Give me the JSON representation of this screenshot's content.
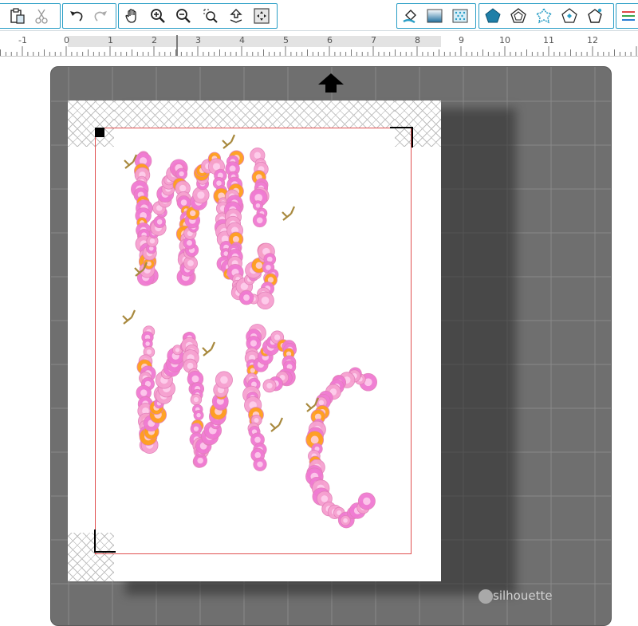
{
  "toolbar": {
    "groups": [
      {
        "name": "clipboard",
        "icons": [
          "paste-icon",
          "cut-icon"
        ]
      },
      {
        "name": "history",
        "icons": [
          "undo-icon",
          "redo-icon"
        ]
      },
      {
        "name": "view",
        "icons": [
          "pan-hand-icon",
          "zoom-in-icon",
          "zoom-out-icon",
          "zoom-select-icon",
          "zoom-fit-icon",
          "fit-to-page-icon"
        ]
      },
      {
        "name": "fill",
        "icons": [
          "fill-bucket-icon",
          "gradient-icon",
          "pattern-icon"
        ]
      },
      {
        "name": "panels",
        "icons": [
          "pentagon-filled-icon",
          "offset-icon",
          "trace-icon",
          "replicate-icon",
          "modify-icon"
        ]
      },
      {
        "name": "menu",
        "icons": [
          "line-style-icon"
        ]
      }
    ],
    "accent_color": "#2a9ec6"
  },
  "ruler": {
    "labels": [
      "-1",
      "0",
      "1",
      "2",
      "3",
      "4",
      "5",
      "6",
      "7",
      "8",
      "9",
      "10",
      "11",
      "12"
    ]
  },
  "workspace": {
    "brand": "silhouette",
    "mat_color": "#6f6f6f",
    "cut_border_color": "#e05050",
    "artwork_colors": [
      "#f07ad2",
      "#f6a1d0",
      "#ff9f1c",
      "#a8893e"
    ]
  }
}
